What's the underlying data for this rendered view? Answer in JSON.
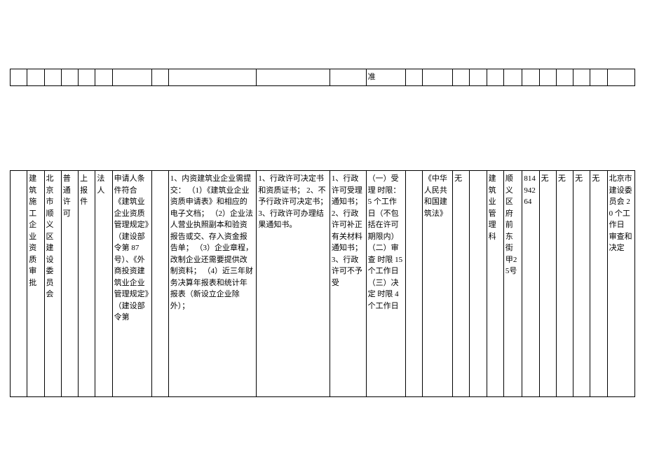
{
  "top_row": {
    "c12": "准"
  },
  "main_row": {
    "c1": "",
    "c2": "建筑施工企业资质审批",
    "c3": "北京市顺义区建设委员会",
    "c4": "普通许可",
    "c5": "上报件",
    "c6": "法人",
    "c7": "申请人条件符合《建筑业企业资质管理规定》（建设部令第 87 号）、《外商投资建筑业企业管理规定》（建设部令第",
    "c8": "",
    "c9": "1、内资建筑业企业需提交：\n（1）《建筑业企业资质申请表》和相应的电子文档；\n（2）企业法人营业执照副本和验资报告或交、存入资金报告单；\n（3）企业章程，改制企业还需要提供改制资料；\n（4）近三年财务决算年报表和统计年报表（新设立企业除外）；",
    "c10": "1、行政许可决定书和资质证书；\n2、不予行政许可决定书；\n3、行政许可办理结果通知书。",
    "c11": "1、行政许可受理通知书；\n2、行政许可补正有关材料通知书；\n3、行政许可不予受",
    "c12": "（一）受理 时限：5 个工作日（不包括在许可期限内）\n（二）审查 时限 15 个工作日\n（三）决定 时限 4 个工作日",
    "c13": "",
    "c14": "《中华人民共和国建筑法》",
    "c15": "无",
    "c16": "",
    "c17": "建筑业管理科",
    "c18": "顺义区府前东街甲25号",
    "c19": "81494264",
    "c20": "无",
    "c21": "无",
    "c22": "无",
    "c23": "无",
    "c24": "北京市建设委员会\n20 个工作日\n审查和决定"
  }
}
